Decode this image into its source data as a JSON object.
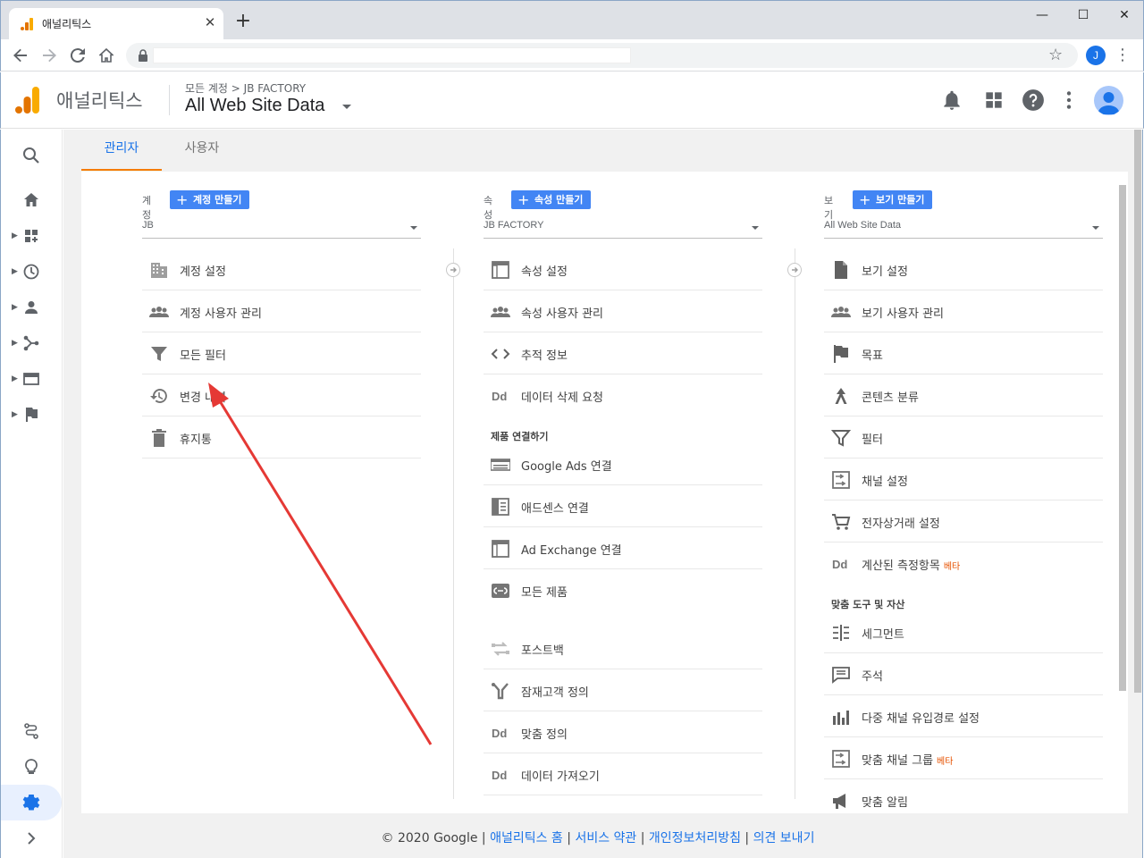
{
  "browser": {
    "tab_title": "애널리틱스",
    "new_tab": "+",
    "window_controls": {
      "minimize": "—",
      "maximize": "☐",
      "close": "✕"
    },
    "profile_initial": "J"
  },
  "ga_header": {
    "brand": "애널리틱스",
    "breadcrumb": "모든 계정 > JB FACTORY",
    "view_title": "All Web Site Data"
  },
  "admin_tabs": [
    {
      "label": "관리자",
      "selected": true
    },
    {
      "label": "사용자",
      "selected": false
    }
  ],
  "account_column": {
    "header": "계정",
    "create_button": "계정 만들기",
    "selected": "JB",
    "items": [
      {
        "label": "계정 설정",
        "icon": "building-icon"
      },
      {
        "label": "계정 사용자 관리",
        "icon": "people-icon"
      },
      {
        "label": "모든 필터",
        "icon": "filter-icon"
      },
      {
        "label": "변경 내역",
        "icon": "history-icon"
      },
      {
        "label": "휴지통",
        "icon": "trash-icon"
      }
    ]
  },
  "property_column": {
    "header": "속성",
    "create_button": "속성 만들기",
    "selected": "JB FACTORY",
    "items": [
      {
        "label": "속성 설정",
        "icon": "property-icon"
      },
      {
        "label": "속성 사용자 관리",
        "icon": "people-icon"
      },
      {
        "label": "추적 정보",
        "icon": "code-icon"
      },
      {
        "label": "데이터 삭제 요청",
        "icon": "dd-icon"
      }
    ],
    "product_linking_header": "제품 연결하기",
    "product_linking": [
      {
        "label": "Google Ads 연결",
        "icon": "ads-icon"
      },
      {
        "label": "애드센스 연결",
        "icon": "adsense-icon"
      },
      {
        "label": "Ad Exchange 연결",
        "icon": "adexchange-icon"
      },
      {
        "label": "모든 제품",
        "icon": "link-icon"
      }
    ],
    "more": [
      {
        "label": "포스트백",
        "icon": "postback-icon"
      },
      {
        "label": "잠재고객 정의",
        "icon": "audience-icon"
      },
      {
        "label": "맞춤 정의",
        "icon": "dd-icon"
      },
      {
        "label": "데이터 가져오기",
        "icon": "dd-icon"
      }
    ]
  },
  "view_column": {
    "header": "보기",
    "create_button": "보기 만들기",
    "selected": "All Web Site Data",
    "items": [
      {
        "label": "보기 설정",
        "icon": "doc-icon"
      },
      {
        "label": "보기 사용자 관리",
        "icon": "people-icon"
      },
      {
        "label": "목표",
        "icon": "flag-icon"
      },
      {
        "label": "콘텐츠 분류",
        "icon": "grouping-icon"
      },
      {
        "label": "필터",
        "icon": "filter-icon"
      },
      {
        "label": "채널 설정",
        "icon": "channel-icon"
      },
      {
        "label": "전자상거래 설정",
        "icon": "cart-icon"
      },
      {
        "label": "계산된 측정항목",
        "icon": "dd-icon",
        "beta": "베타"
      }
    ],
    "tools_header": "맞춤 도구 및 자산",
    "tools": [
      {
        "label": "세그먼트",
        "icon": "segment-icon"
      },
      {
        "label": "주석",
        "icon": "annotation-icon"
      },
      {
        "label": "다중 채널 유입경로 설정",
        "icon": "mcf-icon"
      },
      {
        "label": "맞춤 채널 그룹",
        "icon": "channel-icon",
        "beta": "베타"
      },
      {
        "label": "맞춤 알림",
        "icon": "megaphone-icon"
      }
    ]
  },
  "footer": {
    "copyright": "© 2020 Google",
    "links": [
      "애널리틱스 홈",
      "서비스 약관",
      "개인정보처리방침",
      "의견 보내기"
    ],
    "sep": " | "
  },
  "colors": {
    "accent": "#1a73e8",
    "create_button": "#4285f4",
    "tab_underline": "#f57c00",
    "annotation_arrow": "#e53935",
    "logo_orange": "#f9ab00",
    "logo_dark_orange": "#e37400"
  }
}
